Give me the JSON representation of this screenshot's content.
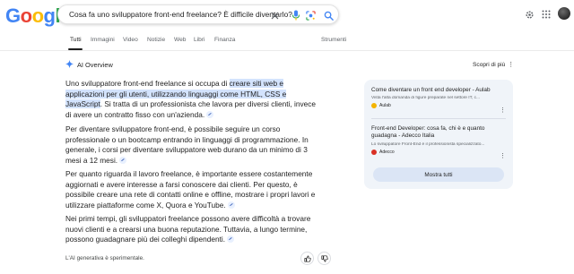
{
  "header": {
    "logo_letters": [
      "G",
      "o",
      "o",
      "g",
      "l",
      "e"
    ],
    "logo_colors": [
      "#4285f4",
      "#ea4335",
      "#fbbc05",
      "#4285f4",
      "#34a853",
      "#ea4335"
    ],
    "search_query": "Cosa fa uno sviluppatore front-end freelance? È difficile diventarlo?",
    "icons": [
      "close-icon",
      "mic-icon",
      "lens-icon",
      "search-icon",
      "settings-icon",
      "apps-icon",
      "avatar"
    ]
  },
  "tabs": {
    "items": [
      "Tutti",
      "Immagini",
      "Video",
      "Notizie",
      "Web",
      "Libri",
      "Finanza"
    ],
    "tools_label": "Strumenti"
  },
  "ai_overview": {
    "title": "AI Overview",
    "learn_more_label": "Scopri di più",
    "paragraphs": {
      "p1": {
        "a": "Uno sviluppatore front-end freelance si occupa di ",
        "highlight": "creare siti web e applicazioni per gli utenti, utilizzando linguaggi come HTML, CSS e JavaScript",
        "b": ". Si tratta di un professionista che lavora per diversi clienti, invece di avere un contratto fisso con un'azienda."
      },
      "p2": "Per diventare sviluppatore front-end, è possibile seguire un corso professionale o un bootcamp entrando in linguaggi di programmazione. In generale, i corsi per diventare sviluppatore web durano da un minimo di 3 mesi a 12 mesi.",
      "p3": "Per quanto riguarda il lavoro freelance, è importante essere costantemente aggiornati e avere interesse a farsi conoscere dai clienti. Per questo, è possibile creare una rete di contatti online e offline, mostrare i propri lavori e utilizzare piattaforme come X, Quora e YouTube.",
      "p4": "Nei primi tempi, gli sviluppatori freelance possono avere difficoltà a trovare nuovi clienti e a crearsi una buona reputazione. Tuttavia, a lungo termine, possono guadagnare più dei colleghi dipendenti."
    },
    "footer_note": "L'AI generativa è sperimentale."
  },
  "sources": {
    "items": [
      {
        "title": "Come diventare un front end developer - Aulab",
        "description": "Vista l'alta domanda di figure preparate nel settore IT, c...",
        "site": "Aulab",
        "favicon_color": "#f4b400"
      },
      {
        "title": "Front-end Developer: cosa fa, chi è e quanto guadagna - Adecco Italia",
        "description": "Lo sviluppatore Front-End è il professionista specializzato...",
        "site": "Adecco",
        "favicon_color": "#d93025"
      }
    ],
    "show_all_label": "Mostra tutti"
  }
}
